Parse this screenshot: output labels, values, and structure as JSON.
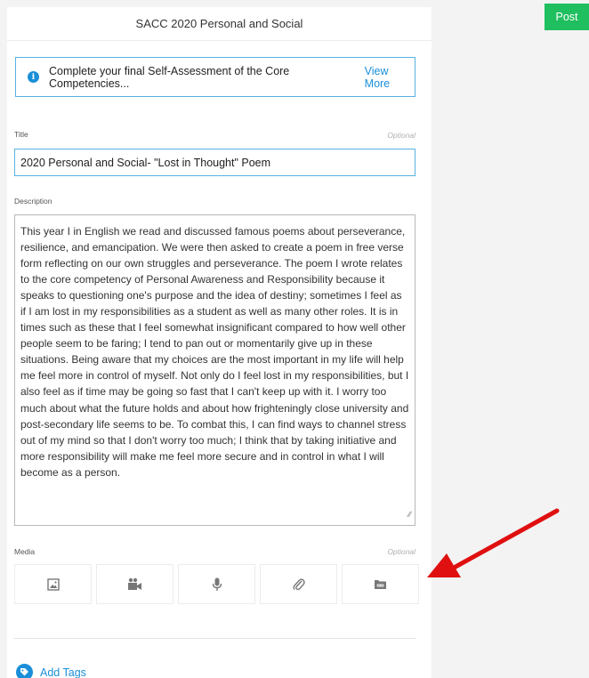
{
  "header": {
    "title": "SACC 2020 Personal and Social",
    "post_label": "Post"
  },
  "notice": {
    "icon": "info-icon",
    "text": "Complete your final Self-Assessment of the Core Competencies...",
    "link": "View More"
  },
  "title_field": {
    "label": "Title",
    "optional": "Optional",
    "value": "2020 Personal and Social- \"Lost in Thought\" Poem"
  },
  "description_field": {
    "label": "Description",
    "value": "This year I in English we read and discussed famous poems about perseverance, resilience, and emancipation.  We were then asked to create a poem in free verse form reflecting on our own struggles and perseverance.  The poem I wrote relates to the core competency of Personal Awareness and Responsibility because it speaks to questioning one's purpose and the idea of destiny; sometimes I feel as if I am lost in my responsibilities as a student as well as many other roles. It is in times such as these that I feel somewhat insignificant compared to how well other people seem to be faring; I tend to pan out or momentarily give up in these situations. Being aware that my choices are the most important in my life will help me feel more in control of myself. Not only do I feel lost in my responsibilities, but I also feel as if time may be going so fast that I can't keep up with it. I worry too much about what the future holds and about how frighteningly close university and post-secondary life seems to be. To combat this, I can find ways to channel stress out of my mind so that I don't worry too much; I think that by taking initiative and more responsibility will make me feel more secure and in control in what I will become as a person."
  },
  "media": {
    "label": "Media",
    "optional": "Optional",
    "buttons": [
      "image-icon",
      "video-icon",
      "microphone-icon",
      "paperclip-icon",
      "link-icon"
    ]
  },
  "tags": {
    "icon": "tag-icon",
    "label": "Add Tags"
  },
  "colors": {
    "accent": "#1a8fd9",
    "post": "#1fbf5f",
    "arrow": "#e01010"
  }
}
